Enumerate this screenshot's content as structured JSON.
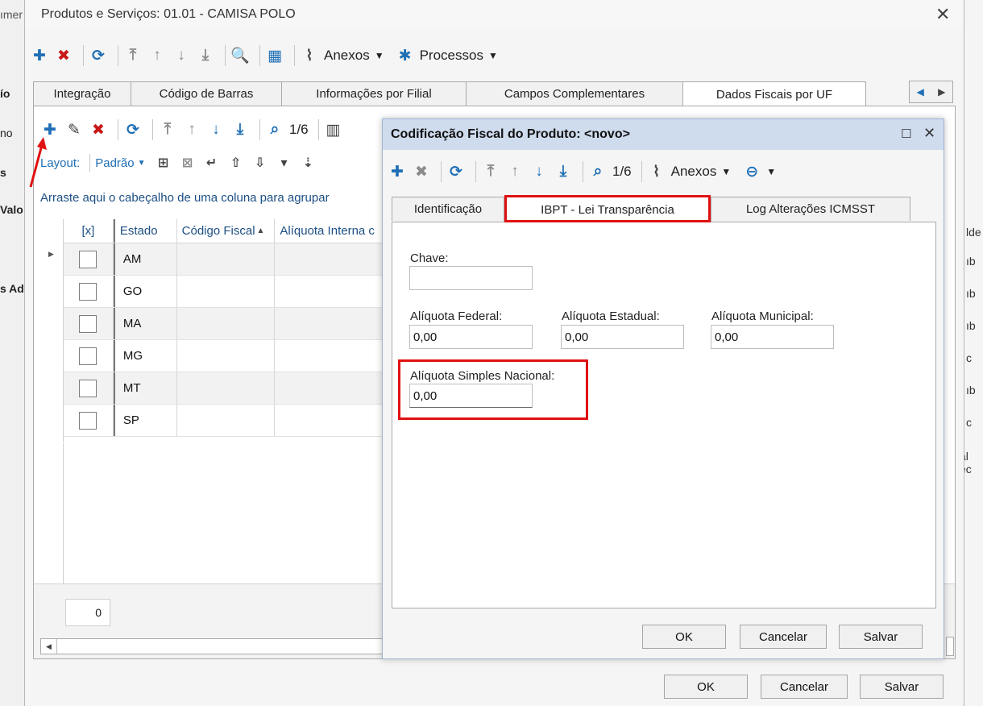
{
  "background": {
    "left_texts": [
      "ımer",
      "ío",
      "no",
      "s",
      "Valo",
      "s Ad"
    ],
    "right_texts": [
      "lde",
      "ıb",
      "ıb",
      "ıb",
      "c",
      "ıb",
      "c",
      "al ec"
    ]
  },
  "main_window": {
    "title": "Produtos e Serviços: 01.01 - CAMISA POLO",
    "toolbar": {
      "anexos": "Anexos",
      "processos": "Processos"
    },
    "tabs": [
      "Integração",
      "Código de Barras",
      "Informações por Filial",
      "Campos Complementares",
      "Dados Fiscais por UF"
    ],
    "sub_toolbar": {
      "pager": "1/6"
    },
    "layout_bar": {
      "layout_label": "Layout:",
      "layout_value": "Padrão"
    },
    "group_hint": "Arraste aqui o cabeçalho de uma coluna para agrupar",
    "grid": {
      "columns": [
        "[x]",
        "Estado",
        "Código Fiscal",
        "Alíquota Interna c"
      ],
      "rows": [
        "AM",
        "GO",
        "MA",
        "MG",
        "MT",
        "SP"
      ]
    },
    "footer_count": "0",
    "buttons": {
      "ok": "OK",
      "cancel": "Cancelar",
      "save": "Salvar"
    }
  },
  "dialog": {
    "title": "Codificação Fiscal do Produto: <novo>",
    "toolbar": {
      "pager": "1/6",
      "anexos": "Anexos"
    },
    "tabs": [
      "Identificação",
      "IBPT - Lei Transparência",
      "Log Alterações ICMSST"
    ],
    "fields": {
      "chave": {
        "label": "Chave:",
        "value": ""
      },
      "aliquota_federal": {
        "label": "Alíquota Federal:",
        "value": "0,00"
      },
      "aliquota_estadual": {
        "label": "Alíquota Estadual:",
        "value": "0,00"
      },
      "aliquota_municipal": {
        "label": "Alíquota Municipal:",
        "value": "0,00"
      },
      "aliquota_simples": {
        "label": "Alíquota Simples Nacional:",
        "value": "0,00"
      }
    },
    "buttons": {
      "ok": "OK",
      "cancel": "Cancelar",
      "save": "Salvar"
    }
  },
  "colors": {
    "highlight": "#e01111",
    "icon_blue": "#1f6fb5",
    "icon_red": "#c81818",
    "dialog_title_bg": "#cfdcee"
  }
}
